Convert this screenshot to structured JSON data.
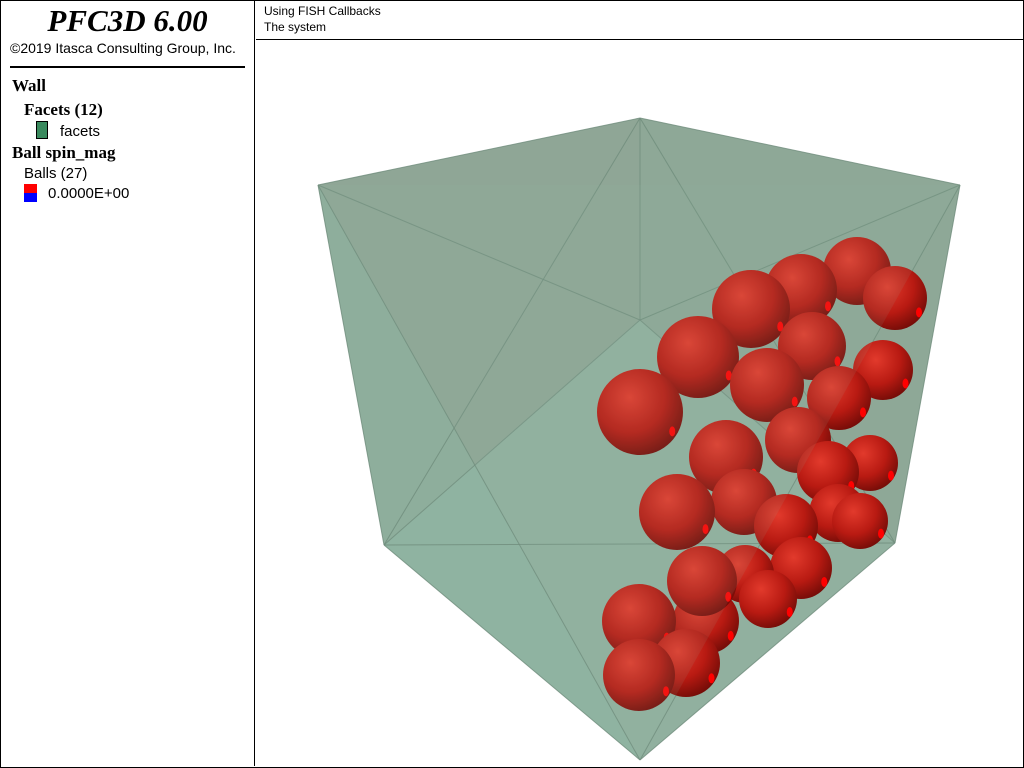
{
  "app": {
    "title": "PFC3D 6.00",
    "copyright": "©2019 Itasca Consulting Group, Inc."
  },
  "header": {
    "line1": "Using FISH Callbacks",
    "line2": "The system"
  },
  "legend": {
    "wall": {
      "heading": "Wall",
      "facets_heading": "Facets (12)",
      "facets_label": "facets",
      "facets_color": "#3a8a5e"
    },
    "ball": {
      "heading": "Ball spin_mag",
      "count_label": "Balls (27)",
      "value_label": "0.0000E+00",
      "swatch_top_color": "#ff0000",
      "swatch_bottom_color": "#0000ff"
    }
  },
  "scene": {
    "wall_color": "#8fb8a3",
    "ball_color": "#c01e14"
  }
}
